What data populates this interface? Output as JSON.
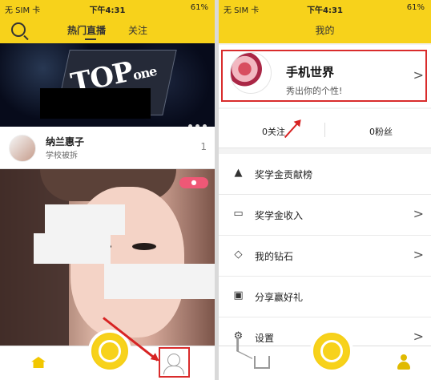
{
  "left": {
    "status": {
      "carrier": "无 SIM 卡",
      "time": "下午4:31",
      "battery": "61%"
    },
    "tabs": {
      "hot": "热门直播",
      "follow": "关注"
    },
    "banner": {
      "text": "TOP",
      "small_text": "one"
    },
    "profile": {
      "name": "纳兰惠子",
      "subtitle": "学校被拆",
      "count": "1"
    },
    "photo": {
      "tag": "●"
    }
  },
  "right": {
    "status": {
      "carrier": "无 SIM 卡",
      "time": "下午4:31",
      "battery": "61%"
    },
    "title": "我的",
    "profile": {
      "name": "手机世界",
      "signature": "秀出你的个性!",
      "chevron": ">"
    },
    "stats": {
      "following": "0关注",
      "fans": "0粉丝"
    },
    "menu": [
      {
        "label": "奖学金贡献榜",
        "icon": "graduation-cap-icon",
        "chevron": ""
      },
      {
        "label": "奖学金收入",
        "icon": "wallet-icon",
        "chevron": ">"
      },
      {
        "label": "我的钻石",
        "icon": "diamond-icon",
        "chevron": ">"
      },
      {
        "label": "分享赢好礼",
        "icon": "gift-icon",
        "chevron": ""
      },
      {
        "label": "设置",
        "icon": "settings-icon",
        "chevron": ">"
      }
    ]
  },
  "colors": {
    "accent": "#f7d21b",
    "highlight": "#d92c2c"
  }
}
